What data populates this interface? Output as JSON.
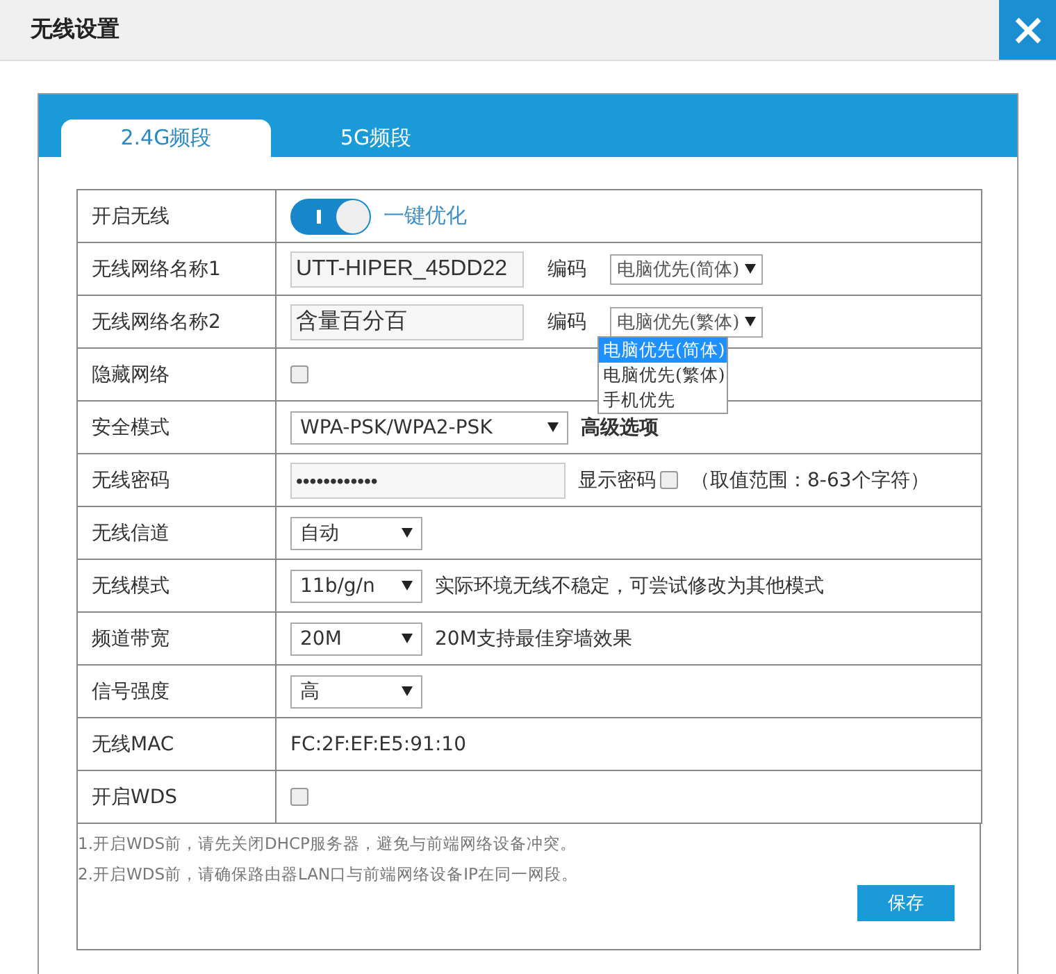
{
  "window": {
    "title": "无线设置"
  },
  "tabs": [
    {
      "label": "2.4G频段",
      "selected": true
    },
    {
      "label": "5G频段",
      "selected": false
    }
  ],
  "rows": [
    {
      "kind": "toggle",
      "label": "开启无线",
      "on": true,
      "link": "一键优化"
    },
    {
      "kind": "ssid",
      "label": "无线网络名称1",
      "value": "UTT-HIPER_45DD22",
      "encoding_label": "编码",
      "encoding": "电脑优先(简体)"
    },
    {
      "kind": "ssid",
      "label": "无线网络名称2",
      "value": "含量百分百",
      "encoding_label": "编码",
      "encoding": "电脑优先(繁体)",
      "expanded": true,
      "options": [
        {
          "label": "电脑优先(简体)",
          "selected": true
        },
        {
          "label": "电脑优先(繁体)",
          "selected": false
        },
        {
          "label": "手机优先",
          "selected": false
        }
      ]
    },
    {
      "kind": "checkbox",
      "label": "隐藏网络",
      "checked": false
    },
    {
      "kind": "select",
      "label": "安全模式",
      "value": "WPA-PSK/WPA2-PSK",
      "wide": true,
      "note": "高级选项",
      "bold_note": true
    },
    {
      "kind": "password",
      "label": "无线密码",
      "value": "••••••••••••",
      "show_label": "显示密码",
      "show_checked": false,
      "note": "（取值范围：8-63个字符）"
    },
    {
      "kind": "select",
      "label": "无线信道",
      "value": "自动"
    },
    {
      "kind": "select",
      "label": "无线模式",
      "value": "11b/g/n",
      "note": "实际环境无线不稳定，可尝试修改为其他模式"
    },
    {
      "kind": "select",
      "label": "频道带宽",
      "value": "20M",
      "note": "20M支持最佳穿墙效果"
    },
    {
      "kind": "select",
      "label": "信号强度",
      "value": "高"
    },
    {
      "kind": "text",
      "label": "无线MAC",
      "value": "FC:2F:EF:E5:91:10"
    },
    {
      "kind": "checkbox",
      "label": "开启WDS",
      "checked": false
    }
  ],
  "notes": [
    "1.开启WDS前，请先关闭DHCP服务器，避免与前端网络设备冲突。",
    "2.开启WDS前，请确保路由器LAN口与前端网络设备IP在同一网段。"
  ],
  "save_button": "保存"
}
